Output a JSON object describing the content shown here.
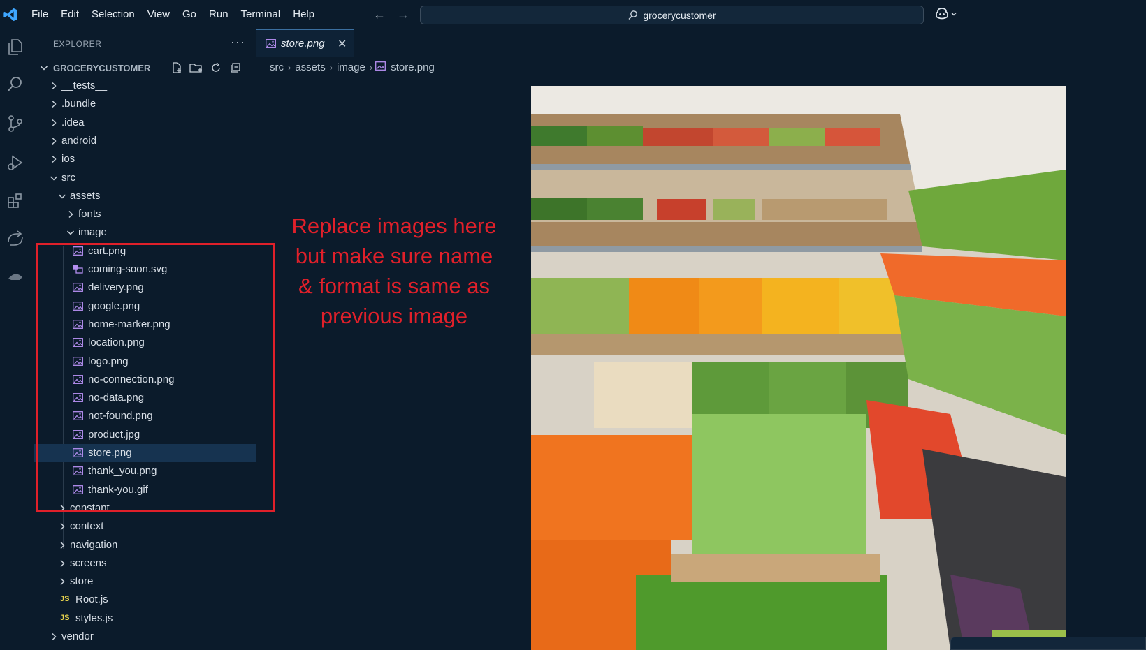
{
  "menu": [
    "File",
    "Edit",
    "Selection",
    "View",
    "Go",
    "Run",
    "Terminal",
    "Help"
  ],
  "command_center": {
    "label": "grocerycustomer"
  },
  "explorer": {
    "title": "EXPLORER",
    "root": "GROCERYCUSTOMER",
    "items": [
      {
        "label": "__tests__",
        "type": "folder",
        "depth": 1,
        "expanded": false
      },
      {
        "label": ".bundle",
        "type": "folder",
        "depth": 1,
        "expanded": false
      },
      {
        "label": ".idea",
        "type": "folder",
        "depth": 1,
        "expanded": false
      },
      {
        "label": "android",
        "type": "folder",
        "depth": 1,
        "expanded": false
      },
      {
        "label": "ios",
        "type": "folder",
        "depth": 1,
        "expanded": false
      },
      {
        "label": "src",
        "type": "folder",
        "depth": 1,
        "expanded": true
      },
      {
        "label": "assets",
        "type": "folder",
        "depth": 2,
        "expanded": true
      },
      {
        "label": "fonts",
        "type": "folder",
        "depth": 3,
        "expanded": false
      },
      {
        "label": "image",
        "type": "folder",
        "depth": 3,
        "expanded": true
      },
      {
        "label": "cart.png",
        "type": "image",
        "depth": 4
      },
      {
        "label": "coming-soon.svg",
        "type": "svg",
        "depth": 4
      },
      {
        "label": "delivery.png",
        "type": "image",
        "depth": 4
      },
      {
        "label": "google.png",
        "type": "image",
        "depth": 4
      },
      {
        "label": "home-marker.png",
        "type": "image",
        "depth": 4
      },
      {
        "label": "location.png",
        "type": "image",
        "depth": 4
      },
      {
        "label": "logo.png",
        "type": "image",
        "depth": 4
      },
      {
        "label": "no-connection.png",
        "type": "image",
        "depth": 4
      },
      {
        "label": "no-data.png",
        "type": "image",
        "depth": 4
      },
      {
        "label": "not-found.png",
        "type": "image",
        "depth": 4
      },
      {
        "label": "product.jpg",
        "type": "image",
        "depth": 4
      },
      {
        "label": "store.png",
        "type": "image",
        "depth": 4,
        "selected": true
      },
      {
        "label": "thank_you.png",
        "type": "image",
        "depth": 4
      },
      {
        "label": "thank-you.gif",
        "type": "image",
        "depth": 4
      },
      {
        "label": "constant",
        "type": "folder",
        "depth": 2,
        "expanded": false
      },
      {
        "label": "context",
        "type": "folder",
        "depth": 2,
        "expanded": false
      },
      {
        "label": "navigation",
        "type": "folder",
        "depth": 2,
        "expanded": false
      },
      {
        "label": "screens",
        "type": "folder",
        "depth": 2,
        "expanded": false
      },
      {
        "label": "store",
        "type": "folder",
        "depth": 2,
        "expanded": false
      },
      {
        "label": "Root.js",
        "type": "js",
        "depth": 2
      },
      {
        "label": "styles.js",
        "type": "js",
        "depth": 2
      },
      {
        "label": "vendor",
        "type": "folder",
        "depth": 1,
        "expanded": false
      }
    ]
  },
  "tab": {
    "label": "store.png"
  },
  "breadcrumb": [
    "src",
    "assets",
    "image",
    "store.png"
  ],
  "annotation": {
    "lines": [
      "Replace images here",
      "but make sure name",
      "& format is same as",
      "previous image"
    ],
    "color": "#e0202a"
  },
  "colors": {
    "background": "#0b1b2b",
    "selected_row": "#163350",
    "accent_file_icon": "#b48ef0"
  }
}
